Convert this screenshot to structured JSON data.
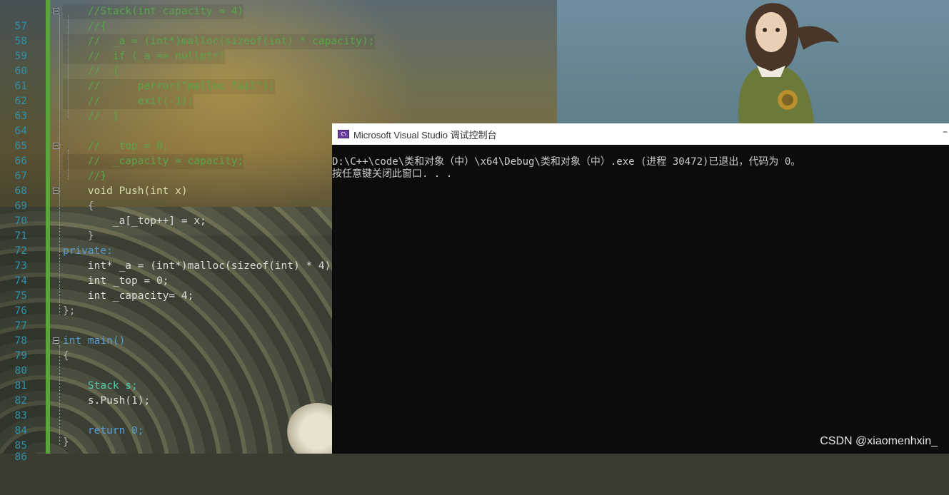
{
  "console": {
    "title": "Microsoft Visual Studio 调试控制台",
    "icon_label": "C\\",
    "minimize_glyph": "–",
    "output_line1": "D:\\C++\\code\\类和对象（中）\\x64\\Debug\\类和对象（中）.exe (进程 30472)已退出，代码为 0。",
    "output_line2": "按任意键关闭此窗口. . ."
  },
  "watermark": "CSDN @xiaomenhxin_",
  "editor": {
    "change_bar_color": "#5aa53a",
    "lines": [
      {
        "n": "57",
        "code": "    //Stack(int capacity = 4)"
      },
      {
        "n": "58",
        "code": "    //{"
      },
      {
        "n": "59",
        "code": "    //  _a = (int*)malloc(sizeof(int) * capacity);"
      },
      {
        "n": "60",
        "code": "    //  if (_a == nullptr)"
      },
      {
        "n": "61",
        "code": "    //  {"
      },
      {
        "n": "62",
        "code": "    //      perror(\"malloc fail\");"
      },
      {
        "n": "63",
        "code": "    //      exit(-1);"
      },
      {
        "n": "64",
        "code": "    //  }"
      },
      {
        "n": "65",
        "code": ""
      },
      {
        "n": "66",
        "code": "    //  _top = 0;"
      },
      {
        "n": "67",
        "code": "    //  _capacity = capacity;"
      },
      {
        "n": "68",
        "code": "    //}"
      },
      {
        "n": "69",
        "code": "    void Push(int x)"
      },
      {
        "n": "70",
        "code": "    {"
      },
      {
        "n": "71",
        "code": "        _a[_top++] = x;"
      },
      {
        "n": "72",
        "code": "    }"
      },
      {
        "n": "73",
        "code": "private:"
      },
      {
        "n": "74",
        "code": "    int* _a = (int*)malloc(sizeof(int) * 4);"
      },
      {
        "n": "75",
        "code": "    int _top = 0;"
      },
      {
        "n": "76",
        "code": "    int _capacity= 4;"
      },
      {
        "n": "77",
        "code": "};"
      },
      {
        "n": "78",
        "code": ""
      },
      {
        "n": "79",
        "code": "int main()"
      },
      {
        "n": "80",
        "code": "{"
      },
      {
        "n": "81",
        "code": ""
      },
      {
        "n": "82",
        "code": "    Stack s;"
      },
      {
        "n": "83",
        "code": "    s.Push(1);"
      },
      {
        "n": "84",
        "code": ""
      },
      {
        "n": "85",
        "code": "    return 0;"
      },
      {
        "n": "86",
        "code": "}"
      }
    ]
  }
}
